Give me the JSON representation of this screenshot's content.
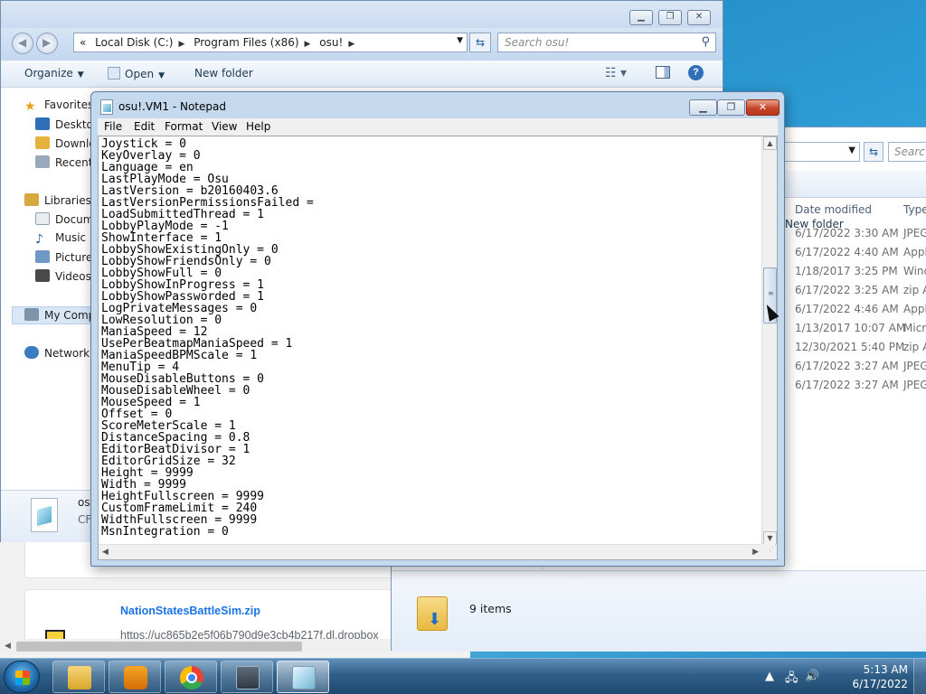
{
  "colors": {
    "link": "#1a73e8",
    "notepad_close": "#c64628",
    "taskbar": "#2f5f88"
  },
  "browser": {
    "download_name": "NationStatesBattleSim.zip",
    "download_url": "https://uc865b2e5f06b790d9e3cb4b217f.dl.dropbox"
  },
  "explorer2": {
    "search_placeholder": "Searc",
    "new_folder_label": "New folder",
    "columns": [
      "Date modified",
      "Type"
    ],
    "rows": [
      {
        "date": "6/17/2022 3:30 AM",
        "type": "JPEG"
      },
      {
        "date": "6/17/2022 4:40 AM",
        "type": "Appl"
      },
      {
        "date": "1/18/2017 3:25 PM",
        "type": "Wind"
      },
      {
        "date": "6/17/2022 3:25 AM",
        "type": "zip A"
      },
      {
        "date": "6/17/2022 4:46 AM",
        "type": "Appl"
      },
      {
        "date": "1/13/2017 10:07 AM",
        "type": "Micr"
      },
      {
        "date": "12/30/2021 5:40 PM",
        "type": "zip A"
      },
      {
        "date": "6/17/2022 3:27 AM",
        "type": "JPEG"
      },
      {
        "date": "6/17/2022 3:27 AM",
        "type": "JPEG"
      }
    ],
    "item_count": "9 items"
  },
  "explorer1": {
    "breadcrumb": {
      "overflow": "«",
      "segments": [
        "Local Disk (C:)",
        "Program Files (x86)",
        "osu!"
      ]
    },
    "search_placeholder": "Search osu!",
    "toolbar": {
      "organize": "Organize",
      "open": "Open",
      "new_folder": "New folder"
    },
    "sidebar": {
      "favorites": "Favorites",
      "desktop": "Desktop",
      "downloads": "Downlo",
      "recent": "Recent P",
      "libraries": "Libraries",
      "documents": "Docume",
      "music": "Music",
      "pictures": "Pictures",
      "videos": "Videos",
      "computer": "My Comp",
      "network": "Network"
    },
    "details": {
      "name": "os",
      "type": "CF"
    }
  },
  "notepad": {
    "title": "osu!.VM1 - Notepad",
    "menu": [
      "File",
      "Edit",
      "Format",
      "View",
      "Help"
    ],
    "lines": [
      "Joystick = 0",
      "KeyOverlay = 0",
      "Language = en",
      "LastPlayMode = Osu",
      "LastVersion = b20160403.6",
      "LastVersionPermissionsFailed =",
      "LoadSubmittedThread = 1",
      "LobbyPlayMode = -1",
      "ShowInterface = 1",
      "LobbyShowExistingOnly = 0",
      "LobbyShowFriendsOnly = 0",
      "LobbyShowFull = 0",
      "LobbyShowInProgress = 1",
      "LobbyShowPassworded = 1",
      "LogPrivateMessages = 0",
      "LowResolution = 0",
      "ManiaSpeed = 12",
      "UsePerBeatmapManiaSpeed = 1",
      "ManiaSpeedBPMScale = 1",
      "MenuTip = 4",
      "MouseDisableButtons = 0",
      "MouseDisableWheel = 0",
      "MouseSpeed = 1",
      "Offset = 0",
      "ScoreMeterScale = 1",
      "DistanceSpacing = 0.8",
      "EditorBeatDivisor = 1",
      "EditorGridSize = 32",
      "Height = 9999",
      "Width = 9999",
      "HeightFullscreen = 9999",
      "CustomFrameLimit = 240",
      "WidthFullscreen = 9999",
      "MsnIntegration = 0"
    ]
  },
  "taskbar": {
    "apps": [
      {
        "name": "windows-explorer",
        "icon": "folder-icon"
      },
      {
        "name": "media-player",
        "icon": "media-player-icon"
      },
      {
        "name": "chrome",
        "icon": "chrome-icon"
      },
      {
        "name": "task-manager",
        "icon": "task-manager-icon"
      },
      {
        "name": "notepad",
        "icon": "notepad-icon"
      }
    ],
    "time": "5:13 AM",
    "date": "6/17/2022"
  }
}
